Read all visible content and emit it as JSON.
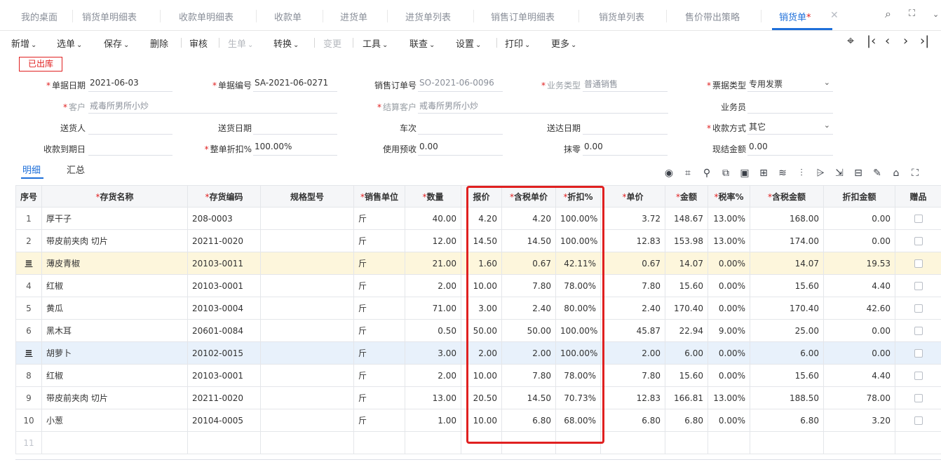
{
  "tabs": [
    {
      "label": "我的桌面"
    },
    {
      "label": "销货单明细表"
    },
    {
      "label": "收款单明细表"
    },
    {
      "label": "收款单"
    },
    {
      "label": "进货单"
    },
    {
      "label": "进货单列表"
    },
    {
      "label": "销售订单明细表"
    },
    {
      "label": "销货单列表"
    },
    {
      "label": "售价带出策略"
    },
    {
      "label": "销货单",
      "active": true,
      "dirty_mark": "*"
    }
  ],
  "tabbar_buttons": {
    "search_icon": "search-icon",
    "maximize_icon": "maximize-icon",
    "more_icon": "chevron-down-icon"
  },
  "toolbar": {
    "new": "新增",
    "select": "选单",
    "save": "保存",
    "delete": "删除",
    "audit": "审核",
    "generate": "生单",
    "convert": "转换",
    "change": "变更",
    "tools": "工具",
    "query": "联查",
    "settings": "设置",
    "print": "打印",
    "more": "更多"
  },
  "status_stamp": "已出库",
  "form": {
    "doc_date": {
      "label": "单据日期",
      "value": "2021-06-03"
    },
    "doc_no": {
      "label": "单据编号",
      "value": "SA-2021-06-0271"
    },
    "so_no": {
      "label": "销售订单号",
      "value": "SO-2021-06-0096"
    },
    "biz_type": {
      "label": "业务类型",
      "value": "普通销售"
    },
    "invoice_type": {
      "label": "票据类型",
      "value": "专用发票"
    },
    "customer": {
      "label": "客户",
      "value": "戒毒所男所小炒"
    },
    "settle_customer": {
      "label": "结算客户",
      "value": "戒毒所男所小炒"
    },
    "salesman": {
      "label": "业务员",
      "value": ""
    },
    "deliverer": {
      "label": "送货人",
      "value": ""
    },
    "delivery_date": {
      "label": "送货日期",
      "value": ""
    },
    "trip": {
      "label": "车次",
      "value": ""
    },
    "arrival_date": {
      "label": "送达日期",
      "value": ""
    },
    "payment_method": {
      "label": "收款方式",
      "value": "其它"
    },
    "due_date": {
      "label": "收款到期日",
      "value": ""
    },
    "discount_rate": {
      "label": "整单折扣%",
      "value": "100.00%"
    },
    "prepay": {
      "label": "使用预收",
      "value": "0.00"
    },
    "rounding": {
      "label": "抹零",
      "value": "0.00"
    },
    "cash_amount": {
      "label": "现结金额",
      "value": "0.00"
    }
  },
  "detail_tabs": {
    "detail": "明细",
    "summary": "汇总"
  },
  "table": {
    "columns": [
      "序号",
      "存货名称",
      "存货编码",
      "规格型号",
      "销售单位",
      "数量",
      "报价",
      "含税单价",
      "折扣%",
      "单价",
      "金额",
      "税率%",
      "含税金额",
      "折扣金额",
      "赠品"
    ],
    "required": [
      false,
      true,
      true,
      false,
      true,
      true,
      false,
      true,
      true,
      true,
      true,
      true,
      true,
      false,
      false
    ],
    "rows": [
      {
        "seq": "1",
        "name": "厚干子",
        "code": "208-0003",
        "spec": "",
        "unit": "斤",
        "qty": "40.00",
        "quote": "4.20",
        "tax_price": "4.20",
        "disc": "100.00%",
        "price": "3.72",
        "amount": "148.67",
        "tax_rate": "13.00%",
        "tax_amount": "168.00",
        "disc_amount": "0.00"
      },
      {
        "seq": "2",
        "name": "带皮前夹肉 切片",
        "code": "20211-0020",
        "spec": "",
        "unit": "斤",
        "qty": "12.00",
        "quote": "14.50",
        "tax_price": "14.50",
        "disc": "100.00%",
        "price": "12.83",
        "amount": "153.98",
        "tax_rate": "13.00%",
        "tax_amount": "174.00",
        "disc_amount": "0.00"
      },
      {
        "seq": "",
        "name": "薄皮青椒",
        "code": "20103-0011",
        "spec": "",
        "unit": "斤",
        "qty": "21.00",
        "quote": "1.60",
        "tax_price": "0.67",
        "disc": "42.11%",
        "price": "0.67",
        "amount": "14.07",
        "tax_rate": "0.00%",
        "tax_amount": "14.07",
        "disc_amount": "19.53",
        "highlight": "yellow"
      },
      {
        "seq": "4",
        "name": "红椒",
        "code": "20103-0001",
        "spec": "",
        "unit": "斤",
        "qty": "2.00",
        "quote": "10.00",
        "tax_price": "7.80",
        "disc": "78.00%",
        "price": "7.80",
        "amount": "15.60",
        "tax_rate": "0.00%",
        "tax_amount": "15.60",
        "disc_amount": "4.40"
      },
      {
        "seq": "5",
        "name": "黄瓜",
        "code": "20103-0004",
        "spec": "",
        "unit": "斤",
        "qty": "71.00",
        "quote": "3.00",
        "tax_price": "2.40",
        "disc": "80.00%",
        "price": "2.40",
        "amount": "170.40",
        "tax_rate": "0.00%",
        "tax_amount": "170.40",
        "disc_amount": "42.60"
      },
      {
        "seq": "6",
        "name": "黑木耳",
        "code": "20601-0084",
        "spec": "",
        "unit": "斤",
        "qty": "0.50",
        "quote": "50.00",
        "tax_price": "50.00",
        "disc": "100.00%",
        "price": "45.87",
        "amount": "22.94",
        "tax_rate": "9.00%",
        "tax_amount": "25.00",
        "disc_amount": "0.00"
      },
      {
        "seq": "",
        "name": "胡萝卜",
        "code": "20102-0015",
        "spec": "",
        "unit": "斤",
        "qty": "3.00",
        "quote": "2.00",
        "tax_price": "2.00",
        "disc": "100.00%",
        "price": "2.00",
        "amount": "6.00",
        "tax_rate": "0.00%",
        "tax_amount": "6.00",
        "disc_amount": "0.00",
        "highlight": "blue"
      },
      {
        "seq": "8",
        "name": "红椒",
        "code": "20103-0001",
        "spec": "",
        "unit": "斤",
        "qty": "2.00",
        "quote": "10.00",
        "tax_price": "7.80",
        "disc": "78.00%",
        "price": "7.80",
        "amount": "15.60",
        "tax_rate": "0.00%",
        "tax_amount": "15.60",
        "disc_amount": "4.40"
      },
      {
        "seq": "9",
        "name": "带皮前夹肉 切片",
        "code": "20211-0020",
        "spec": "",
        "unit": "斤",
        "qty": "13.00",
        "quote": "20.50",
        "tax_price": "14.50",
        "disc": "70.73%",
        "price": "12.83",
        "amount": "166.81",
        "tax_rate": "13.00%",
        "tax_amount": "188.50",
        "disc_amount": "78.00"
      },
      {
        "seq": "10",
        "name": "小葱",
        "code": "20104-0005",
        "spec": "",
        "unit": "斤",
        "qty": "1.00",
        "quote": "10.00",
        "tax_price": "6.80",
        "disc": "68.00%",
        "price": "6.80",
        "amount": "6.80",
        "tax_rate": "0.00%",
        "tax_amount": "6.80",
        "disc_amount": "3.20"
      }
    ],
    "empty_row_seq": "11"
  },
  "colors": {
    "accent": "#1e6fd9",
    "highlight_box": "#e02020",
    "row_yellow": "#fdf6dc",
    "row_blue": "#e8f1fb"
  }
}
